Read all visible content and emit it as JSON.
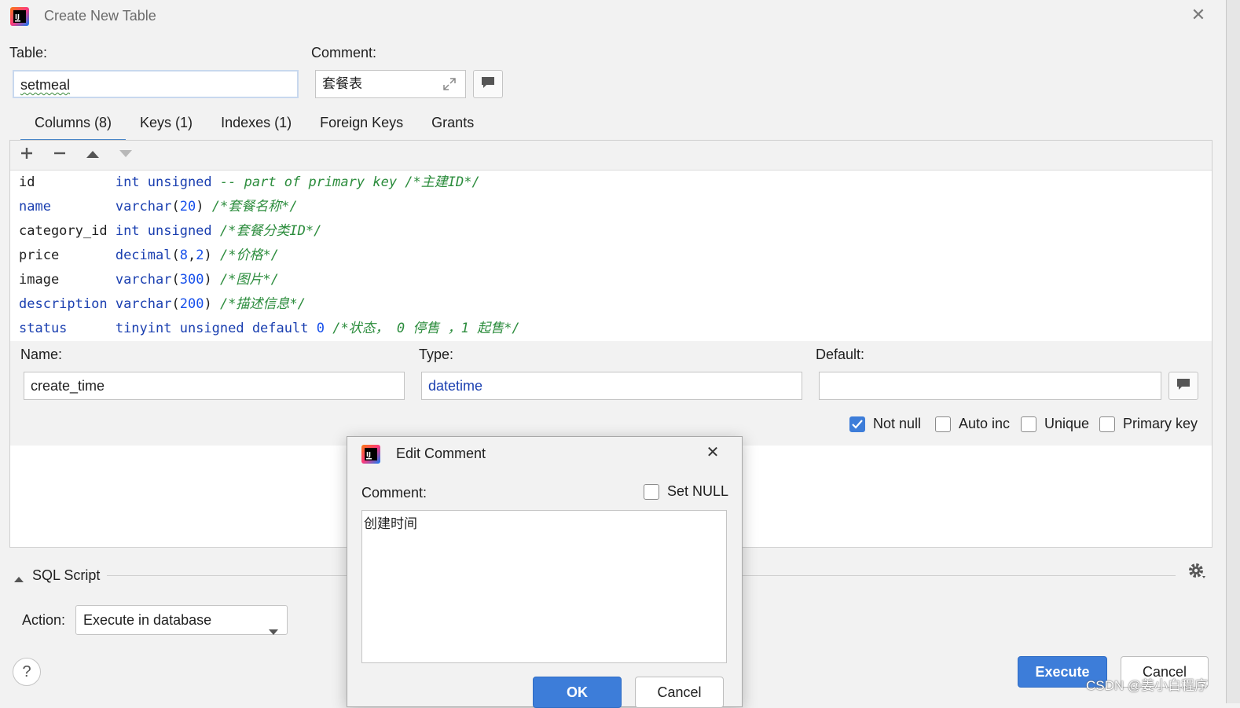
{
  "window": {
    "title": "Create New Table",
    "table_label": "Table:",
    "table_value": "setmeal",
    "comment_label": "Comment:",
    "comment_value": "套餐表"
  },
  "tabs": [
    {
      "label": "Columns (8)",
      "active": true
    },
    {
      "label": "Keys (1)"
    },
    {
      "label": "Indexes (1)"
    },
    {
      "label": "Foreign Keys"
    },
    {
      "label": "Grants"
    }
  ],
  "toolbar": {
    "add_icon": "plus-icon",
    "remove_icon": "minus-icon",
    "up_icon": "arrow-up-icon",
    "down_icon": "arrow-down-icon"
  },
  "columns": [
    {
      "name": "id",
      "parts": [
        [
          "kw",
          "int unsigned "
        ],
        [
          "cm",
          "-- part of primary key /*主建ID*/"
        ]
      ]
    },
    {
      "name": "name",
      "parts": [
        [
          "kw",
          "varchar"
        ],
        [
          "black",
          "("
        ],
        [
          "num",
          "20"
        ],
        [
          "black",
          ") "
        ],
        [
          "cm",
          "/*套餐名称*/"
        ]
      ]
    },
    {
      "name": "category_id",
      "parts": [
        [
          "kw",
          "int unsigned "
        ],
        [
          "cm",
          "/*套餐分类ID*/"
        ]
      ]
    },
    {
      "name": "price",
      "parts": [
        [
          "kw",
          "decimal"
        ],
        [
          "black",
          "("
        ],
        [
          "num",
          "8"
        ],
        [
          "black",
          ","
        ],
        [
          "num",
          "2"
        ],
        [
          "black",
          ") "
        ],
        [
          "cm",
          "/*价格*/"
        ]
      ]
    },
    {
      "name": "image",
      "parts": [
        [
          "kw",
          "varchar"
        ],
        [
          "black",
          "("
        ],
        [
          "num",
          "300"
        ],
        [
          "black",
          ") "
        ],
        [
          "cm",
          "/*图片*/"
        ]
      ]
    },
    {
      "name": "description",
      "parts": [
        [
          "kw",
          "varchar"
        ],
        [
          "black",
          "("
        ],
        [
          "num",
          "200"
        ],
        [
          "black",
          ") "
        ],
        [
          "cm",
          "/*描述信息*/"
        ]
      ]
    },
    {
      "name": "status",
      "parts": [
        [
          "kw",
          "tinyint unsigned default "
        ],
        [
          "num",
          "0"
        ],
        [
          "black",
          " "
        ],
        [
          "cm",
          "/*状态， 0 停售 ，1 起售*/"
        ]
      ]
    }
  ],
  "column_editor": {
    "name_label": "Name:",
    "name_value": "create_time",
    "type_label": "Type:",
    "type_value": "datetime",
    "default_label": "Default:",
    "default_value": "",
    "not_null_label": "Not null",
    "auto_inc_label": "Auto inc",
    "unique_label": "Unique",
    "primary_key_label": "Primary key"
  },
  "sql_script": {
    "label": "SQL Script",
    "action_label": "Action:",
    "action_value": "Execute in database"
  },
  "buttons": {
    "execute": "Execute",
    "cancel": "Cancel",
    "help": "?"
  },
  "dialog": {
    "title": "Edit Comment",
    "comment_label": "Comment:",
    "set_null_label": "Set NULL",
    "comment_text": "创建时间",
    "ok": "OK",
    "cancel": "Cancel"
  },
  "watermark": "CSDN @姜小白程序",
  "colors": {
    "accent": "#3d7dd9",
    "keyword": "#1a3fb0",
    "comment": "#2b8c3c"
  }
}
